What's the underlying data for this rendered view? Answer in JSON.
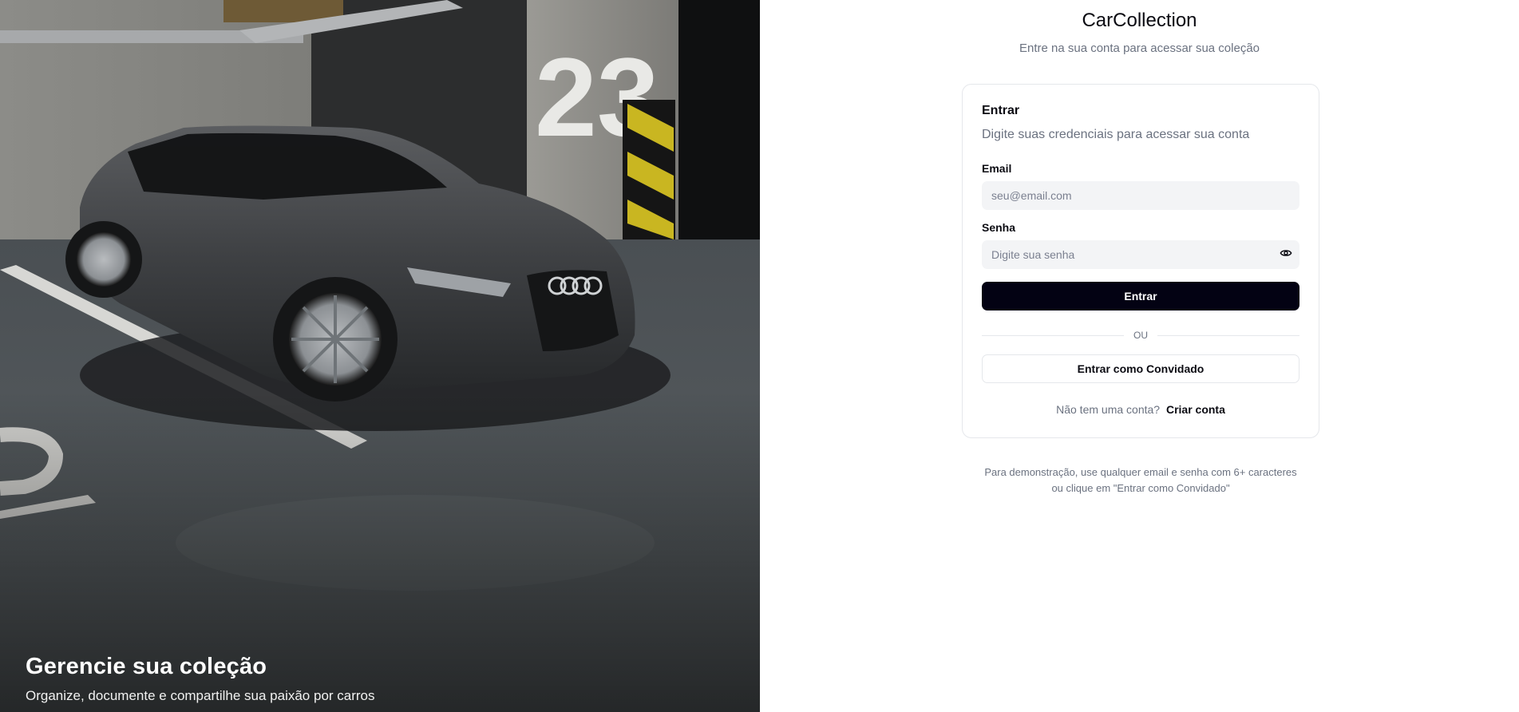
{
  "hero": {
    "title": "Gerencie sua coleção",
    "subtitle": "Organize, documente e compartilhe sua paixão por carros",
    "pillar_number": "23"
  },
  "header": {
    "title": "CarCollection",
    "subtitle": "Entre na sua conta para acessar sua coleção"
  },
  "login_card": {
    "title": "Entrar",
    "description": "Digite suas credenciais para acessar sua conta",
    "email_label": "Email",
    "email_placeholder": "seu@email.com",
    "email_value": "",
    "password_label": "Senha",
    "password_placeholder": "Digite sua senha",
    "password_value": "",
    "password_toggle_icon": "eye-icon",
    "submit_label": "Entrar",
    "divider_text": "OU",
    "guest_label": "Entrar como Convidado",
    "signup_prompt": "Não tem uma conta?",
    "signup_link": "Criar conta"
  },
  "demo_note": {
    "line1": "Para demonstração, use qualquer email e senha com 6+ caracteres",
    "line2": "ou clique em \"Entrar como Convidado\""
  },
  "colors": {
    "primary": "#030213",
    "muted_text": "#6b7280",
    "input_bg": "#f3f4f6",
    "border": "#e5e7eb"
  }
}
